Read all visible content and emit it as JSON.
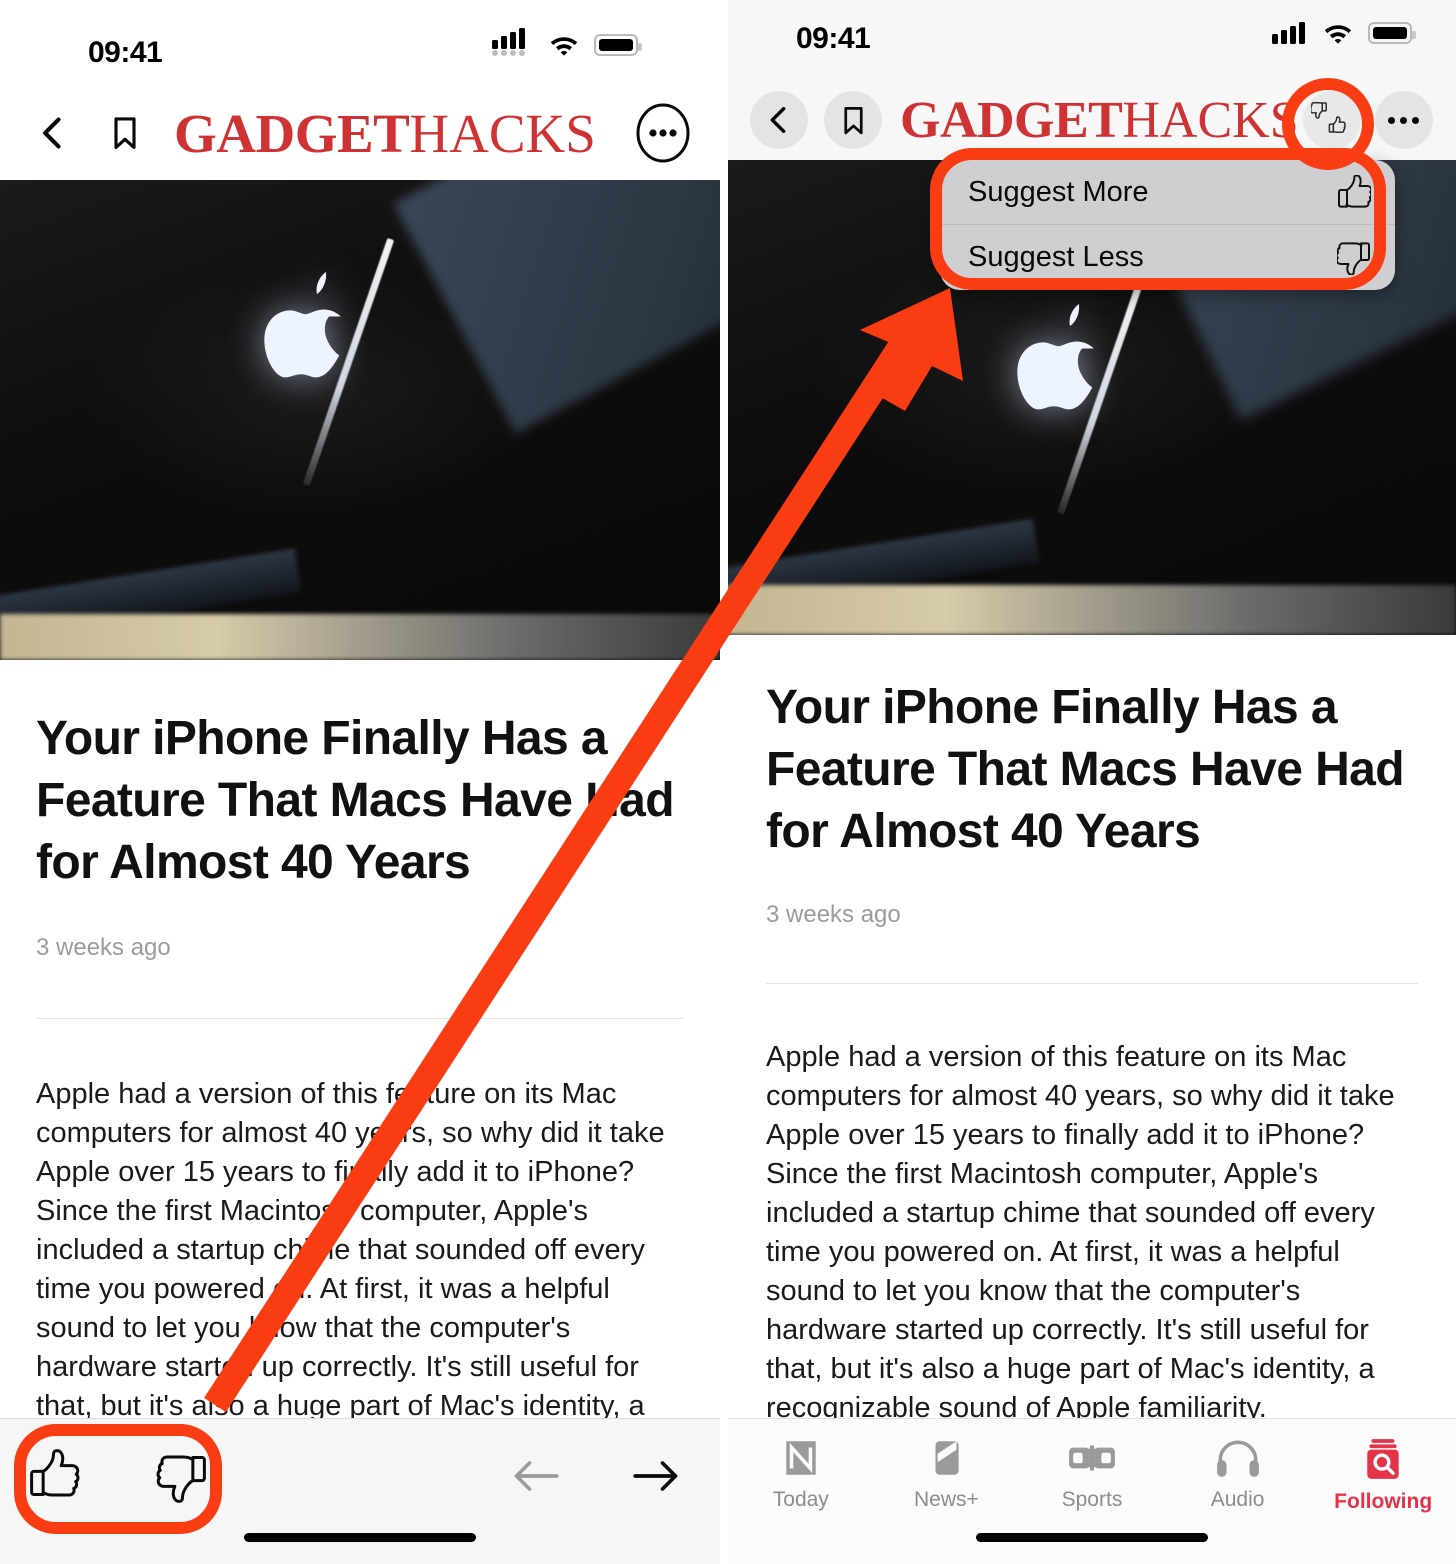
{
  "meta": {
    "accent_red": "#fa3c12",
    "brand_red": "#cf3232",
    "following_red": "#e3344a"
  },
  "status_bar": {
    "time": "09:41",
    "icons": [
      "cellular-signal-icon",
      "wifi-icon",
      "battery-icon"
    ]
  },
  "nav": {
    "back_icon": "chevron-left-icon",
    "bookmark_icon": "bookmark-icon",
    "logo_bold": "GADGET",
    "logo_light": "HACKS",
    "more_icon": "ellipsis-icon",
    "suggest_icon": "thumbs-up-down-icon"
  },
  "article": {
    "headline": "Your iPhone Finally Has a Feature That Macs Have Had for Almost 40 Years",
    "timestamp": "3 weeks ago",
    "body_left": "Apple had a version of this feature on its Mac computers for almost 40 years, so why did it take Apple over 15 years to finally add it to iPhone? Since the first Macintosh computer, Apple's included a startup chime that sounded off every time you powered on. At first, it was a helpful sound to let you know that the computer's hardware started up correctly. It's still useful for that, but it's also a huge part of Mac's identity, a recognizable sound of Apple",
    "body_right": "Apple had a version of this feature on its Mac computers for almost 40 years, so why did it take Apple over 15 years to finally add it to iPhone? Since the first Macintosh computer, Apple's included a startup chime that sounded off every time you powered on. At first, it was a helpful sound to let you know that the computer's hardware started up correctly. It's still useful for that, but it's also a huge part of Mac's identity, a recognizable sound of Apple familiarity.",
    "hero_image_alt": "glowing-apple-logo-on-dark-iphone-screen"
  },
  "bottom_bar": {
    "thumbs_up_icon": "thumbs-up-icon",
    "thumbs_down_icon": "thumbs-down-icon",
    "prev_icon": "arrow-left-icon",
    "next_icon": "arrow-right-icon"
  },
  "popup_menu": {
    "items": [
      {
        "label": "Suggest More",
        "icon": "thumbs-up-icon"
      },
      {
        "label": "Suggest Less",
        "icon": "thumbs-down-icon"
      }
    ]
  },
  "tab_bar": {
    "tabs": [
      {
        "label": "Today",
        "icon": "news-n-icon",
        "active": false
      },
      {
        "label": "News+",
        "icon": "news-plus-icon",
        "active": false
      },
      {
        "label": "Sports",
        "icon": "sports-icon",
        "active": false
      },
      {
        "label": "Audio",
        "icon": "headphones-icon",
        "active": false
      },
      {
        "label": "Following",
        "icon": "search-jar-icon",
        "active": true
      }
    ]
  },
  "annotations": {
    "highlight_color": "#fa3c12",
    "shapes": [
      {
        "name": "thumbs-buttons-highlight-rect",
        "panel": "left"
      },
      {
        "name": "suggest-icon-highlight-circle",
        "panel": "right"
      },
      {
        "name": "popup-menu-highlight-rect",
        "panel": "right"
      },
      {
        "name": "pointer-arrow",
        "panel": "both"
      }
    ]
  }
}
